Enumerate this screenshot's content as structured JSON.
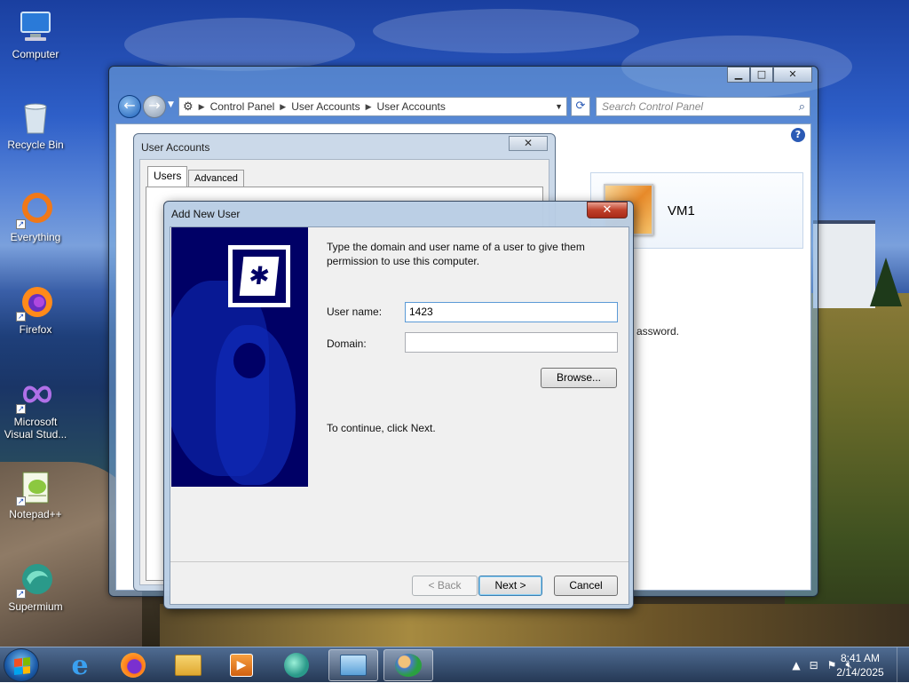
{
  "desktop_icons": [
    {
      "label": "Computer",
      "icon": "computer-icon"
    },
    {
      "label": "Recycle Bin",
      "icon": "recycle-bin-icon"
    },
    {
      "label": "Everything",
      "icon": "everything-icon"
    },
    {
      "label": "Firefox",
      "icon": "firefox-icon"
    },
    {
      "label": "Microsoft Visual Stud...",
      "icon": "visual-studio-icon"
    },
    {
      "label": "Notepad++",
      "icon": "notepad-plus-plus-icon"
    },
    {
      "label": "Supermium",
      "icon": "supermium-icon"
    }
  ],
  "control_panel": {
    "breadcrumb": [
      "Control Panel",
      "User Accounts",
      "User Accounts"
    ],
    "search_placeholder": "Search Control Panel",
    "user_name": "VM1",
    "password_fragment": "assword."
  },
  "user_accounts_dialog": {
    "title": "User Accounts",
    "tabs": [
      "Users",
      "Advanced"
    ]
  },
  "add_new_user": {
    "title": "Add New User",
    "instructions": "Type the domain and user name of a user to give them permission to use this computer.",
    "username_label": "User name:",
    "username_value": "1423",
    "domain_label": "Domain:",
    "domain_value": "",
    "browse_label": "Browse...",
    "continue_text": "To continue, click Next.",
    "back_label": "< Back",
    "next_label": "Next >",
    "cancel_label": "Cancel"
  },
  "taskbar": {
    "apps": [
      "internet-explorer-icon",
      "firefox-icon",
      "file-explorer-icon",
      "media-player-icon",
      "supermium-icon",
      "control-panel-icon",
      "user-accounts-icon"
    ],
    "clock_time": "8:41 AM",
    "clock_date": "2/14/2025"
  },
  "colors": {
    "banner": "#000066",
    "accent": "#1b5fb8",
    "close_red": "#c0402a"
  }
}
